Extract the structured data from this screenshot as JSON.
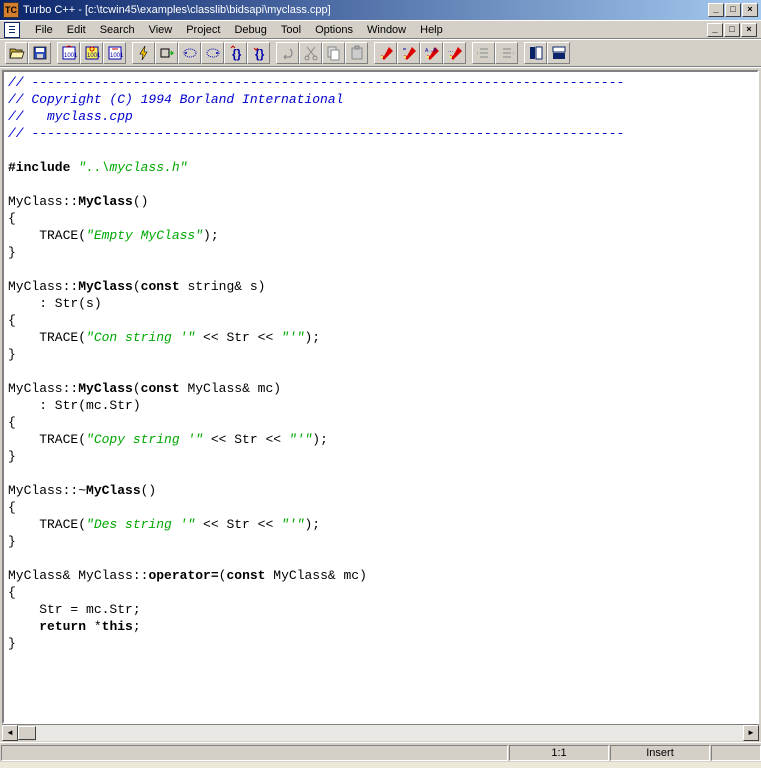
{
  "title": "Turbo C++ - [c:\\tcwin45\\examples\\classlib\\bidsapi\\myclass.cpp]",
  "menu": {
    "file": "File",
    "edit": "Edit",
    "search": "Search",
    "view": "View",
    "project": "Project",
    "debug": "Debug",
    "tool": "Tool",
    "options": "Options",
    "window": "Window",
    "help": "Help"
  },
  "code": {
    "l1": "// ----------------------------------------------------------------------------",
    "l2": "// Copyright (C) 1994 Borland International",
    "l3": "//   myclass.cpp",
    "l4": "// ----------------------------------------------------------------------------",
    "inc": "#include ",
    "incs": "\"..\\myclass.h\"",
    "c1a": "MyClass::",
    "c1b": "MyClass",
    "c1c": "()",
    "ob": "{",
    "cb": "}",
    "tr": "    TRACE(",
    "tre": ");",
    "s1": "\"Empty MyClass\"",
    "c2a": "MyClass::",
    "c2b": "MyClass",
    "c2c": "(",
    "const": "const",
    "c2d": " string& s)",
    "i2": "    : Str(s)",
    "s2": "\"Con string '\"",
    "mid": " << Str << ",
    "s2b": "\"'\"",
    "c3d": " MyClass& mc)",
    "i3": "    : Str(mc.Str)",
    "s3": "\"Copy string '\"",
    "c4a": "MyClass::~",
    "c4b": "MyClass",
    "s4": "\"Des string '\"",
    "c5a": "MyClass& MyClass::",
    "c5b": "operator=",
    "c5c": "(",
    "l5a": "    Str = mc.Str;",
    "l5b": "    ",
    "ret": "return",
    "l5c": " *",
    "this": "this",
    "l5d": ";"
  },
  "status": {
    "pos": "1:1",
    "mode": "Insert"
  }
}
